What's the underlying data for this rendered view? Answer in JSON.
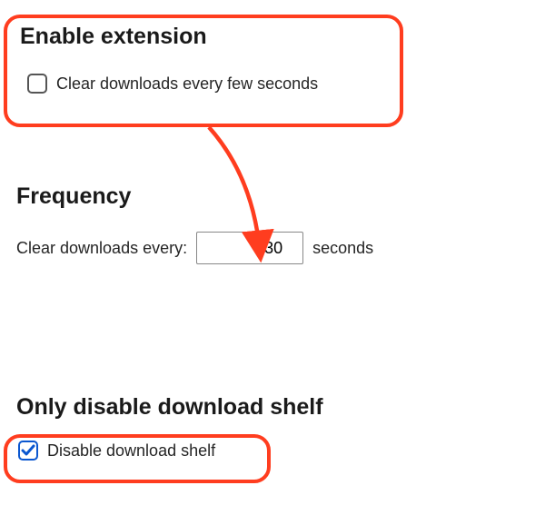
{
  "enable": {
    "heading": "Enable extension",
    "checkbox_label": "Clear downloads every few seconds",
    "checked": false
  },
  "frequency": {
    "heading": "Frequency",
    "label_before": "Clear downloads every:",
    "value": "30",
    "label_after": "seconds"
  },
  "shelf": {
    "heading": "Only disable download shelf",
    "checkbox_label": "Disable download shelf",
    "checked": true
  }
}
